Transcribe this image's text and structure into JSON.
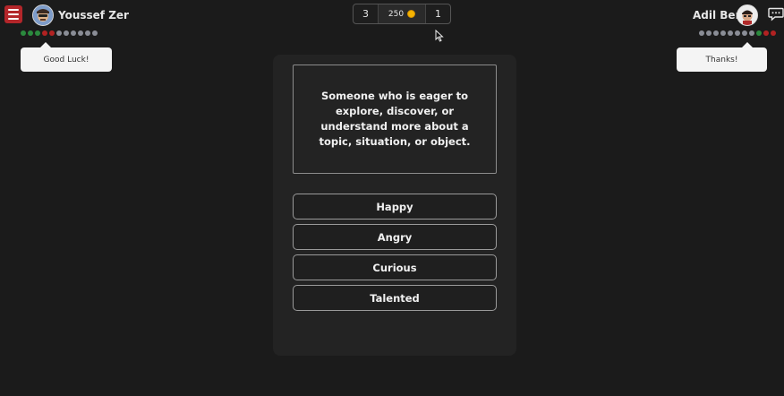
{
  "player_left": {
    "name": "Youssef Zer",
    "dots": [
      "green",
      "green",
      "green",
      "red",
      "red",
      "gray",
      "gray",
      "gray",
      "gray",
      "gray",
      "gray"
    ],
    "bubble": "Good Luck!"
  },
  "player_right": {
    "name": "Adil Ben",
    "dots": [
      "gray",
      "gray",
      "gray",
      "gray",
      "gray",
      "gray",
      "gray",
      "gray",
      "green",
      "red",
      "red"
    ],
    "bubble": "Thanks!"
  },
  "score": {
    "left": "3",
    "pot": "250",
    "right": "1"
  },
  "question": {
    "prompt": "Someone who is eager to explore, discover, or understand more about a topic, situation, or object."
  },
  "options": [
    "Happy",
    "Angry",
    "Curious",
    "Talented"
  ],
  "colors": {
    "background": "#1b1b1b",
    "menu_button": "#b3262a",
    "dot_green": "#2b8a3e",
    "dot_red": "#b22222",
    "dot_gray": "#8a8d96",
    "coin": "#f5b301"
  },
  "icons": {
    "menu": "hamburger-icon",
    "coin": "coin-icon",
    "chat": "chat-bubble-icon",
    "cursor": "mouse-cursor-icon"
  }
}
